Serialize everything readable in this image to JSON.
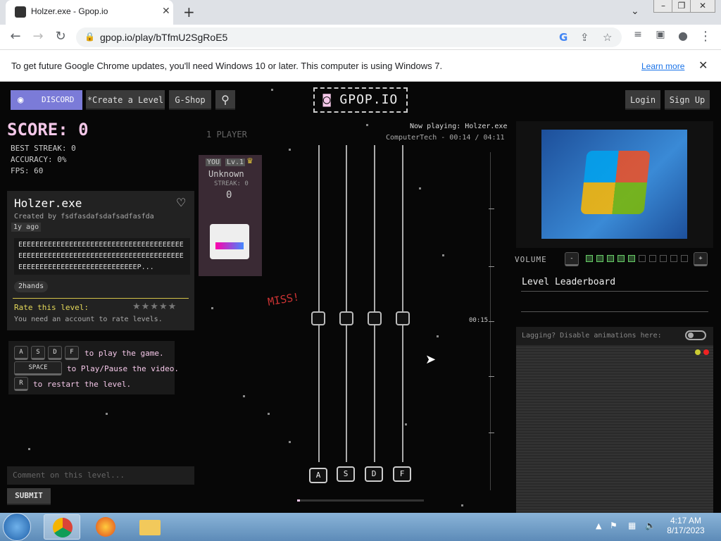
{
  "browser": {
    "tab_title": "Holzer.exe - Gpop.io",
    "tab_close": "✕",
    "new_tab": "+",
    "url": "gpop.io/play/bTfmU2SgRoE5",
    "tab_dropdown": "⌄"
  },
  "infobar": {
    "message": "To get future Google Chrome updates, you'll need Windows 10 or later. This computer is using Windows 7.",
    "link": "Learn more",
    "close": "✕"
  },
  "nav": {
    "discord": "DISCORD",
    "create": "*Create a Level",
    "shop": "G-Shop",
    "logo": "GPOP.IO",
    "login": "Login",
    "signup": "Sign Up"
  },
  "stats": {
    "score": "SCORE: 0",
    "best_streak": "BEST STREAK: 0",
    "accuracy": "ACCURACY: 0%",
    "fps": "FPS: 60"
  },
  "level": {
    "title": "Holzer.exe",
    "creator": "Created by fsdfasdafsdafsadfasfda",
    "age": "1y ago",
    "description": "EEEEEEEEEEEEEEEEEEEEEEEEEEEEEEEEEEEEEEEEEEEEEEEEEEEEEEEEEEEEEEEEEEEEEEEEEEEEEEEEEEEEEEEEEEEEEEEEEEEEEEEEEEP...",
    "tag": "2hands",
    "rate_label": "Rate this level:",
    "rate_note": "You need an account to rate levels."
  },
  "controls": {
    "keys": [
      "A",
      "S",
      "D",
      "F"
    ],
    "keys_text": "to play the game.",
    "space": "SPACE",
    "space_text": "to Play/Pause the video.",
    "restart": "R",
    "restart_text": "to restart the level."
  },
  "player": {
    "mode": "1 PLAYER",
    "you": "YOU",
    "lvl": "Lv.1",
    "name": "Unknown",
    "streak": "STREAK: 0",
    "score": "0"
  },
  "game": {
    "now_playing": "Now playing: Holzer.exe",
    "channel_time": "ComputerTech - 00:14 / 04:11",
    "miss": "MISS!",
    "time_marker": "00:15",
    "progress": 0.02,
    "lane_keys": [
      "A",
      "S",
      "D",
      "F"
    ]
  },
  "right": {
    "volume_label": "VOLUME",
    "volume_minus": "-",
    "volume_plus": "+",
    "volume_level": 5,
    "volume_max": 10,
    "leaderboard": "Level Leaderboard",
    "lag_text": "Lagging? Disable animations here:"
  },
  "comment": {
    "placeholder": "Comment on this level...",
    "submit": "SUBMIT"
  },
  "taskbar": {
    "time": "4:17 AM",
    "date": "8/17/2023"
  }
}
